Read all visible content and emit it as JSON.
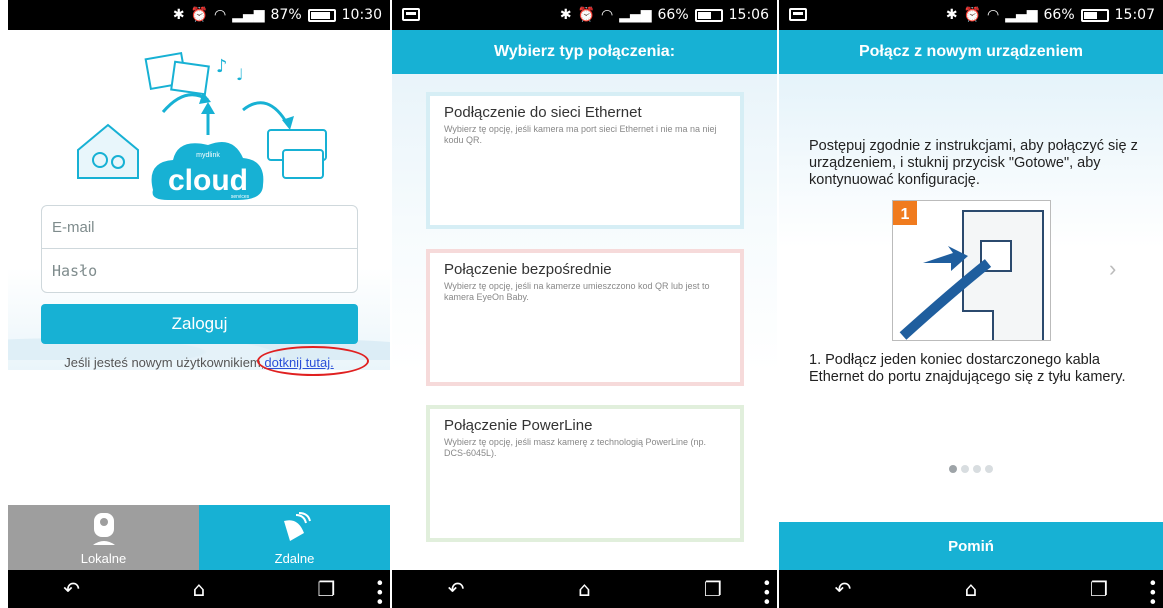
{
  "screen1": {
    "status": {
      "percent": "87%",
      "time": "10:30",
      "battery_level": 0.87
    },
    "logo": {
      "brand_small": "mydlink",
      "brand": "cloud",
      "sub": "services"
    },
    "email_placeholder": "E-mail",
    "password_placeholder": "Hasło",
    "login_label": "Zaloguj",
    "register_text": "Jeśli jesteś nowym użytkownikiem,",
    "register_link": "dotknij tutaj.",
    "tabs": {
      "local": "Lokalne",
      "remote": "Zdalne"
    }
  },
  "screen2": {
    "status": {
      "percent": "66%",
      "time": "15:06",
      "battery_level": 0.66
    },
    "title": "Wybierz typ połączenia:",
    "options": [
      {
        "title": "Podłączenie do sieci Ethernet",
        "desc": "Wybierz tę opcję, jeśli kamera ma port sieci Ethernet i nie ma na niej kodu QR."
      },
      {
        "title": "Połączenie bezpośrednie",
        "desc": "Wybierz tę opcję, jeśli na kamerze umieszczono kod QR lub jest to kamera EyeOn Baby."
      },
      {
        "title": "Połączenie PowerLine",
        "desc": "Wybierz tę opcję, jeśli masz kamerę z technologią PowerLine (np. DCS-6045L)."
      }
    ]
  },
  "screen3": {
    "status": {
      "percent": "66%",
      "time": "15:07",
      "battery_level": 0.66
    },
    "title": "Połącz z nowym urządzeniem",
    "instruction": "Postępuj zgodnie z instrukcjami, aby połączyć się z urządzeniem, i stuknij przycisk \"Gotowe\", aby kontynuować konfigurację.",
    "step_badge": "1",
    "step_text": "1. Podłącz jeden koniec dostarczonego kabla Ethernet do portu znajdującego się z tyłu kamery.",
    "pager": {
      "current": 1,
      "total": 4
    },
    "skip_label": "Pomiń"
  },
  "colors": {
    "accent": "#17b1d4",
    "tab_inactive": "#9e9e9e",
    "link": "#2a4fd8",
    "highlight": "#e02020"
  },
  "icons": [
    "bluetooth-icon",
    "alarm-icon",
    "wifi-icon",
    "signal-icon",
    "battery-icon",
    "back-icon",
    "home-icon",
    "recents-icon",
    "overflow-menu-icon",
    "camera-icon",
    "satellite-icon",
    "chevron-right-icon"
  ]
}
